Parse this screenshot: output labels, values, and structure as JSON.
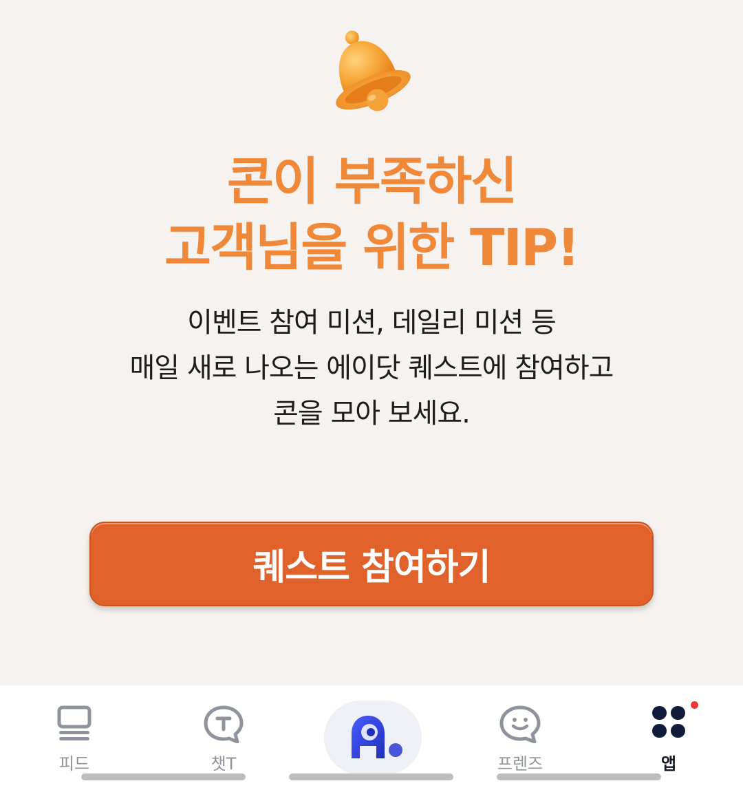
{
  "headline": {
    "line1": "콘이 부족하신",
    "line2": "고객님을 위한 TIP!"
  },
  "description": {
    "line1": "이벤트 참여 미션, 데일리 미션 등",
    "line2": "매일 새로 나오는 에이닷 퀘스트에 참여하고",
    "line3": "콘을 모아 보세요."
  },
  "cta": {
    "label": "퀘스트 참여하기"
  },
  "colors": {
    "accent": "#f0883a",
    "button": "#e0622a",
    "background": "#f5f2ef",
    "notification": "#e8393b"
  },
  "nav": {
    "items": [
      {
        "label": "피드",
        "icon": "feed-icon"
      },
      {
        "label": "챗T",
        "icon": "chat-t-icon"
      },
      {
        "label": "",
        "icon": "adot-character-icon"
      },
      {
        "label": "프렌즈",
        "icon": "friends-icon"
      },
      {
        "label": "앱",
        "icon": "apps-grid-icon",
        "active": true,
        "badge": true
      }
    ]
  }
}
